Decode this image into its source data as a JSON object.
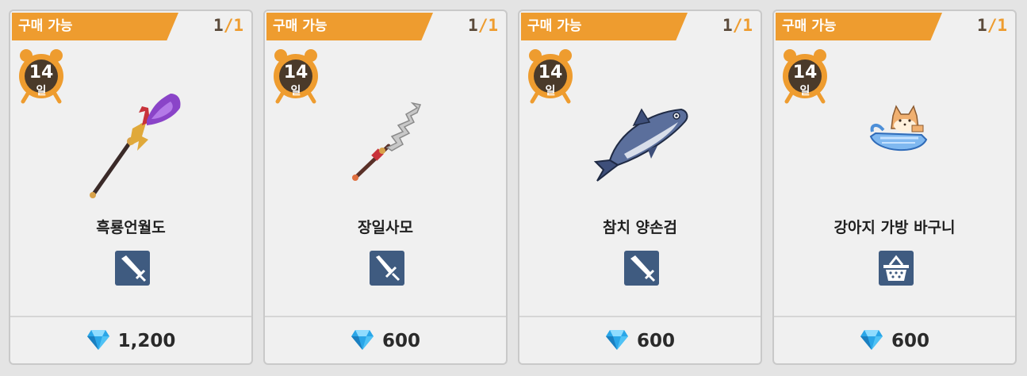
{
  "cards": [
    {
      "badge": "구매 가능",
      "stock_current": "1",
      "stock_sep": "/",
      "stock_max": "1",
      "days_number": "14",
      "days_unit": "일",
      "name": "흑룡언월도",
      "category_icon": "sword-icon",
      "price": "1,200",
      "currency_icon": "diamond-icon"
    },
    {
      "badge": "구매 가능",
      "stock_current": "1",
      "stock_sep": "/",
      "stock_max": "1",
      "days_number": "14",
      "days_unit": "일",
      "name": "장일사모",
      "category_icon": "sword-icon",
      "price": "600",
      "currency_icon": "diamond-icon"
    },
    {
      "badge": "구매 가능",
      "stock_current": "1",
      "stock_sep": "/",
      "stock_max": "1",
      "days_number": "14",
      "days_unit": "일",
      "name": "참치 양손검",
      "category_icon": "sword-icon",
      "price": "600",
      "currency_icon": "diamond-icon"
    },
    {
      "badge": "구매 가능",
      "stock_current": "1",
      "stock_sep": "/",
      "stock_max": "1",
      "days_number": "14",
      "days_unit": "일",
      "name": "강아지 가방 바구니",
      "category_icon": "basket-icon",
      "price": "600",
      "currency_icon": "diamond-icon"
    }
  ],
  "colors": {
    "banner": "#ee9c2f",
    "clock": "#ee9c2f",
    "clock_face": "#4a3a2a",
    "category_bg": "#3f5b80",
    "diamond": "#2aa6e8"
  }
}
